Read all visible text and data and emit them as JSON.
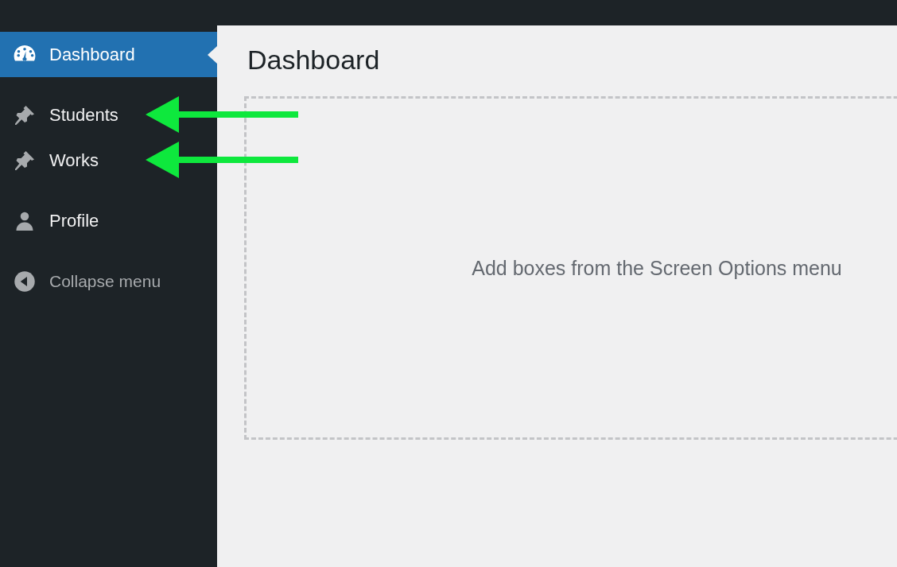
{
  "sidebar": {
    "items": [
      {
        "label": "Dashboard",
        "kind": "dashboard",
        "selected": true,
        "arrow": false
      },
      {
        "label": "Students",
        "kind": "post",
        "selected": false,
        "arrow": true
      },
      {
        "label": "Works",
        "kind": "post",
        "selected": false,
        "arrow": true
      },
      {
        "label": "Profile",
        "kind": "profile",
        "selected": false,
        "arrow": false
      },
      {
        "label": "Collapse menu",
        "kind": "collapse",
        "selected": false,
        "arrow": false
      }
    ]
  },
  "main": {
    "title": "Dashboard",
    "empty_message": "Add boxes from the Screen Options menu"
  }
}
